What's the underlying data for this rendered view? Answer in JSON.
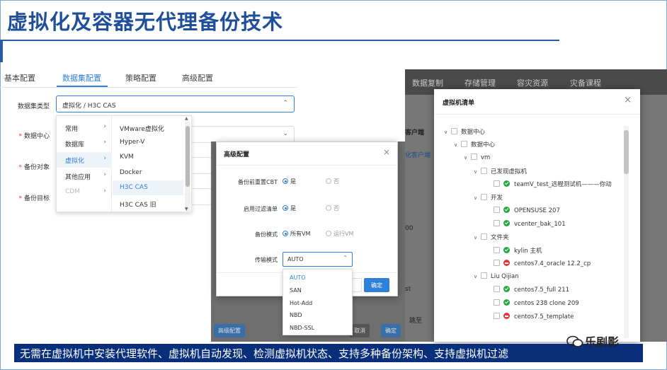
{
  "slide": {
    "title": "虚拟化及容器无代理备份技术",
    "caption": "无需在虚拟机中安装代理软件、虚拟机自动发现、检测虚拟机状态、支持多种备份架构、支持虚拟机过滤",
    "watermark": "乐剧影"
  },
  "config": {
    "tabs": [
      "基本配置",
      "数据集配置",
      "策略配置",
      "高级配置"
    ],
    "active_tab": "数据集配置",
    "fields": {
      "dataset_type_label": "数据集类型",
      "dataset_type_value": "虚拟化 / H3C CAS",
      "data_center_label": "数据中心",
      "backup_object_label": "备份对象",
      "backup_target_label": "备份目标"
    },
    "cascader": {
      "level1": [
        {
          "label": "常用",
          "arrow": "›"
        },
        {
          "label": "数据库",
          "arrow": "›"
        },
        {
          "label": "虚拟化",
          "arrow": "›"
        },
        {
          "label": "其他应用",
          "arrow": "›"
        },
        {
          "label": "CDM",
          "arrow": "›"
        }
      ],
      "level2": [
        "VMware虚拟化",
        "Hyper-V",
        "KVM",
        "Docker",
        "H3C CAS",
        "H3C CAS 旧"
      ]
    }
  },
  "advanced_modal": {
    "title": "高级配置",
    "close": "×",
    "rows": [
      {
        "label": "备份前重置CBT",
        "opt1": "是",
        "opt2": "否"
      },
      {
        "label": "启用过滤清单",
        "opt1": "是",
        "opt2": "否"
      },
      {
        "label": "备份模式",
        "opt1": "所有VM",
        "opt2": "运行VM"
      }
    ],
    "transfer_label": "传输模式",
    "transfer_value": "AUTO",
    "transfer_options": [
      "AUTO",
      "SAN",
      "Hot-Add",
      "NBD",
      "NBD-SSL"
    ],
    "ok": "确定"
  },
  "background": {
    "nav": [
      "数据复制",
      "存储管理",
      "容灾资源",
      "灾备课程"
    ],
    "client_label": "客户端",
    "client_tab": "化客户端",
    "mid_button": "高级配置",
    "mid_cancel": "取消",
    "mid_ok": "确定",
    "partial_left": "00",
    "partial_st": "st",
    "jump_label": "跳至"
  },
  "vm_list": {
    "title": "虚拟机清单",
    "close": "×",
    "nodes": [
      {
        "label": "数据中心",
        "status": "none",
        "toggle": "∨"
      },
      {
        "label": "数据中心",
        "status": "none",
        "toggle": "∨"
      },
      {
        "label": "vm",
        "status": "none",
        "toggle": "∨"
      },
      {
        "label": "已发现虚拟机",
        "status": "none",
        "toggle": "∨"
      },
      {
        "label": "teamV_test_远程测试机———你动",
        "status": "ok",
        "toggle": ""
      },
      {
        "label": "开发",
        "status": "none",
        "toggle": "∨"
      },
      {
        "label": "OPENSUSE 207",
        "status": "ok",
        "toggle": ""
      },
      {
        "label": "vcenter_bak_101",
        "status": "ok",
        "toggle": ""
      },
      {
        "label": "文件夹",
        "status": "none",
        "toggle": "∨"
      },
      {
        "label": "kylin 主机",
        "status": "ok",
        "toggle": ""
      },
      {
        "label": "centos7.4_oracle 12.2_cp",
        "status": "err",
        "toggle": ""
      },
      {
        "label": "Liu Qijian",
        "status": "none",
        "toggle": "∨"
      },
      {
        "label": "centos7.5_full 211",
        "status": "ok",
        "toggle": ""
      },
      {
        "label": "centos 238 clone 209",
        "status": "ok",
        "toggle": ""
      },
      {
        "label": "centos7.5_template",
        "status": "err",
        "toggle": ""
      }
    ]
  },
  "colors": {
    "accent": "#2f80d8",
    "title": "#1f4e9a",
    "caption_bg": "#0a2f7a",
    "ok": "#27a744",
    "err": "#e53935"
  }
}
